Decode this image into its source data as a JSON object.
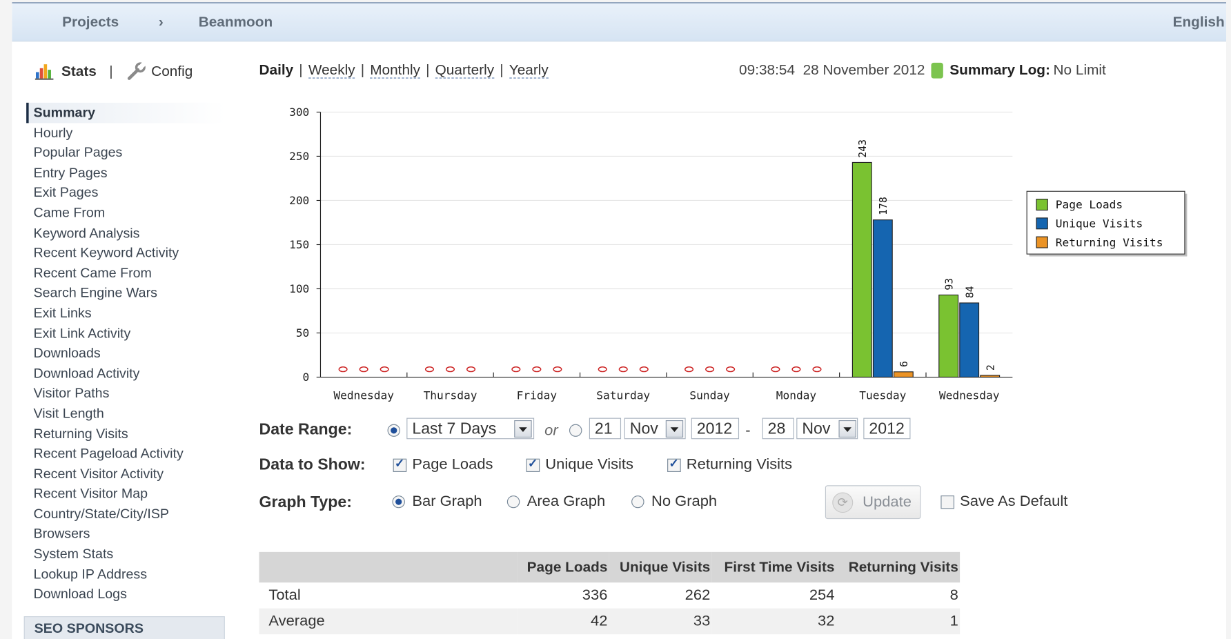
{
  "header": {
    "breadcrumb": [
      "Projects",
      "Beanmoon"
    ],
    "separator": "›",
    "language": "English"
  },
  "sidebar": {
    "stats_label": "Stats",
    "pipe": "|",
    "config_label": "Config",
    "items": [
      "Summary",
      "Hourly",
      "Popular Pages",
      "Entry Pages",
      "Exit Pages",
      "Came From",
      "Keyword Analysis",
      "Recent Keyword Activity",
      "Recent Came From",
      "Search Engine Wars",
      "Exit Links",
      "Exit Link Activity",
      "Downloads",
      "Download Activity",
      "Visitor Paths",
      "Visit Length",
      "Returning Visits",
      "Recent Pageload Activity",
      "Recent Visitor Activity",
      "Recent Visitor Map",
      "Country/State/City/ISP",
      "Browsers",
      "System Stats",
      "Lookup IP Address",
      "Download Logs"
    ],
    "active_index": 0,
    "sponsors": "SEO SPONSORS"
  },
  "period_tabs": {
    "selected": "Daily",
    "links": [
      "Weekly",
      "Monthly",
      "Quarterly",
      "Yearly"
    ],
    "separator": "|"
  },
  "time_info": {
    "time": "09:38:54",
    "date": "28 November 2012",
    "status_color": "#7cc44f",
    "log_label": "Summary Log:",
    "log_value": "No Limit"
  },
  "chart_data": {
    "type": "bar",
    "categories": [
      "Wednesday",
      "Thursday",
      "Friday",
      "Saturday",
      "Sunday",
      "Monday",
      "Tuesday",
      "Wednesday"
    ],
    "series": [
      {
        "name": "Page Loads",
        "color": "#7ac231",
        "values": [
          0,
          0,
          0,
          0,
          0,
          0,
          243,
          93
        ]
      },
      {
        "name": "Unique Visits",
        "color": "#1565b0",
        "values": [
          0,
          0,
          0,
          0,
          0,
          0,
          178,
          84
        ]
      },
      {
        "name": "Returning Visits",
        "color": "#eb9325",
        "values": [
          0,
          0,
          0,
          0,
          0,
          0,
          6,
          2
        ]
      }
    ],
    "ylim": [
      0,
      300
    ],
    "yticks": [
      0,
      50,
      100,
      150,
      200,
      250,
      300
    ],
    "grid": true,
    "legend": "right",
    "zero_marker": "red-ellipse"
  },
  "controls": {
    "date_range_label": "Date Range:",
    "range_preset": "Last 7 Days",
    "or_label": "or",
    "from_day": "21",
    "from_month": "Nov",
    "from_year": "2012",
    "dash": "-",
    "to_day": "28",
    "to_month": "Nov",
    "to_year": "2012",
    "data_label": "Data to Show:",
    "data_options": [
      "Page Loads",
      "Unique Visits",
      "Returning Visits"
    ],
    "graph_label": "Graph Type:",
    "graph_options": [
      "Bar Graph",
      "Area Graph",
      "No Graph"
    ],
    "graph_selected": "Bar Graph",
    "update_label": "Update",
    "save_default_label": "Save As Default"
  },
  "summary_table": {
    "columns": [
      "",
      "Page Loads",
      "Unique Visits",
      "First Time Visits",
      "Returning Visits"
    ],
    "rows": [
      [
        "Total",
        "336",
        "262",
        "254",
        "8"
      ],
      [
        "Average",
        "42",
        "33",
        "32",
        "1"
      ]
    ]
  }
}
